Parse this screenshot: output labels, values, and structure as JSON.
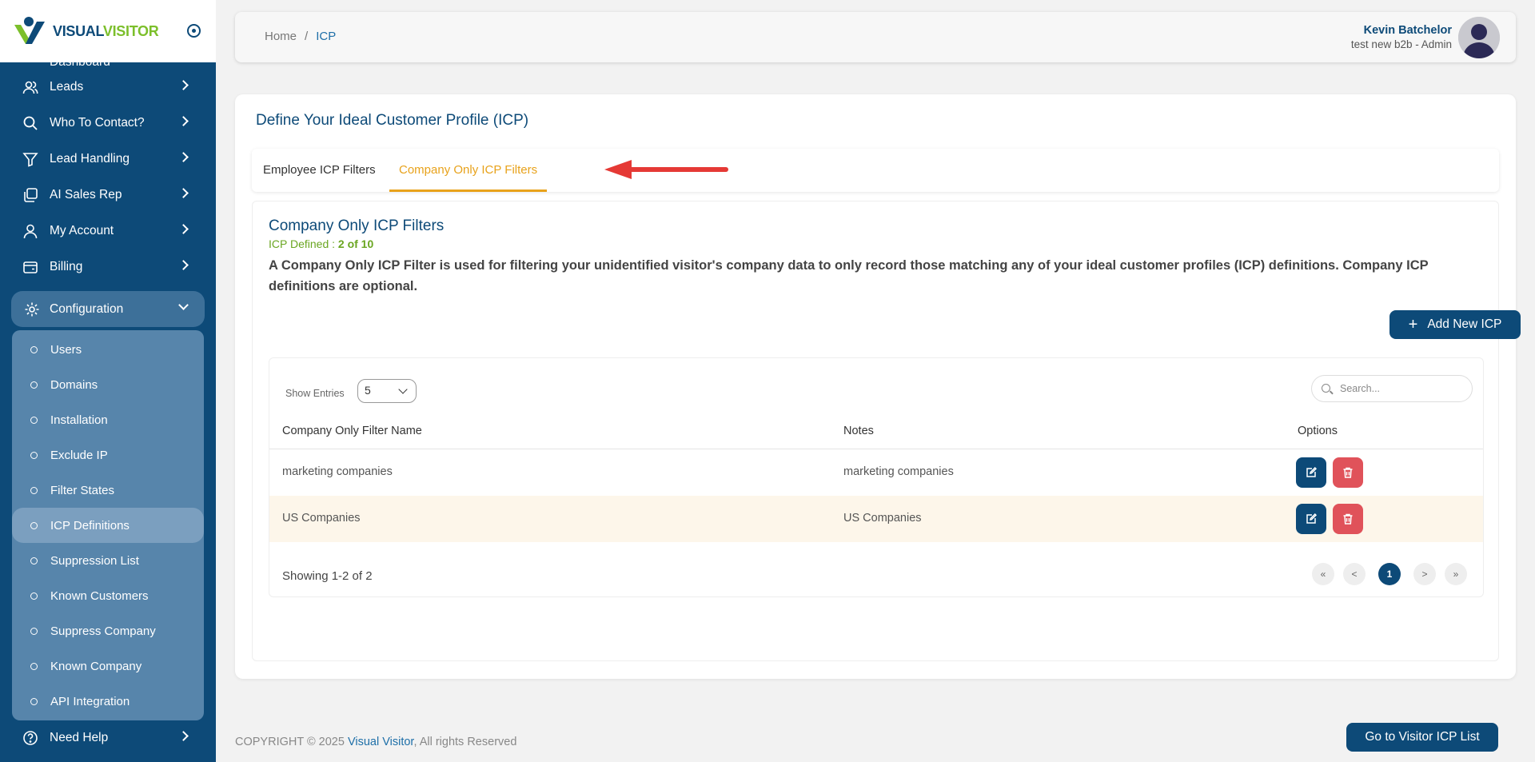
{
  "brand": {
    "name_part1": "VISUAL",
    "name_part2": "VISITOR"
  },
  "sidebar": {
    "partial_item": "Dashboard",
    "items": [
      {
        "label": "Leads",
        "icon": "users-icon"
      },
      {
        "label": "Who To Contact?",
        "icon": "search-icon"
      },
      {
        "label": "Lead Handling",
        "icon": "filter-icon"
      },
      {
        "label": "AI Sales Rep",
        "icon": "copy-icon"
      },
      {
        "label": "My Account",
        "icon": "user-icon"
      },
      {
        "label": "Billing",
        "icon": "wallet-icon"
      }
    ],
    "config": {
      "label": "Configuration",
      "icon": "gear-icon"
    },
    "subitems": [
      "Users",
      "Domains",
      "Installation",
      "Exclude IP",
      "Filter States",
      "ICP Definitions",
      "Suppression List",
      "Known Customers",
      "Suppress Company",
      "Known Company",
      "API Integration"
    ],
    "active_subitem": "ICP Definitions",
    "help": {
      "label": "Need Help",
      "icon": "help-icon"
    }
  },
  "header": {
    "breadcrumb_home": "Home",
    "breadcrumb_sep": "/",
    "breadcrumb_current": "ICP",
    "user_name": "Kevin Batchelor",
    "user_role": "test new b2b - Admin"
  },
  "page": {
    "title": "Define Your Ideal Customer Profile (ICP)",
    "tabs": [
      "Employee ICP Filters",
      "Company Only ICP Filters"
    ],
    "active_tab": "Company Only ICP Filters"
  },
  "panel": {
    "title": "Company Only ICP Filters",
    "defined_label": "ICP Defined : ",
    "defined_value": "2 of 10",
    "description": "A Company Only ICP Filter is used for filtering your unidentified visitor's company data to only record those matching any of your ideal customer profiles (ICP) definitions. Company ICP definitions are optional.",
    "add_button": "Add New ICP",
    "visitor_button": "Go to Visitor ICP List"
  },
  "table": {
    "show_entries_label": "Show Entries",
    "entries_value": "5",
    "search_placeholder": "Search...",
    "columns": [
      "Company Only Filter Name",
      "Notes",
      "Options"
    ],
    "rows": [
      {
        "name": "marketing companies",
        "notes": "marketing companies"
      },
      {
        "name": "US Companies",
        "notes": "US Companies"
      }
    ],
    "showing": "Showing 1-2 of 2",
    "pagination": [
      "«",
      "<",
      "1",
      ">",
      "»"
    ],
    "current_page": "1"
  },
  "footer": {
    "prefix": "COPYRIGHT © 2025 ",
    "brand": "Visual Visitor",
    "suffix": ", All rights Reserved"
  },
  "colors": {
    "primary": "#0d4a78",
    "accent_tab": "#e8a21b",
    "success_text": "#6aa621",
    "danger": "#e0525a",
    "arrow": "#e53935"
  }
}
